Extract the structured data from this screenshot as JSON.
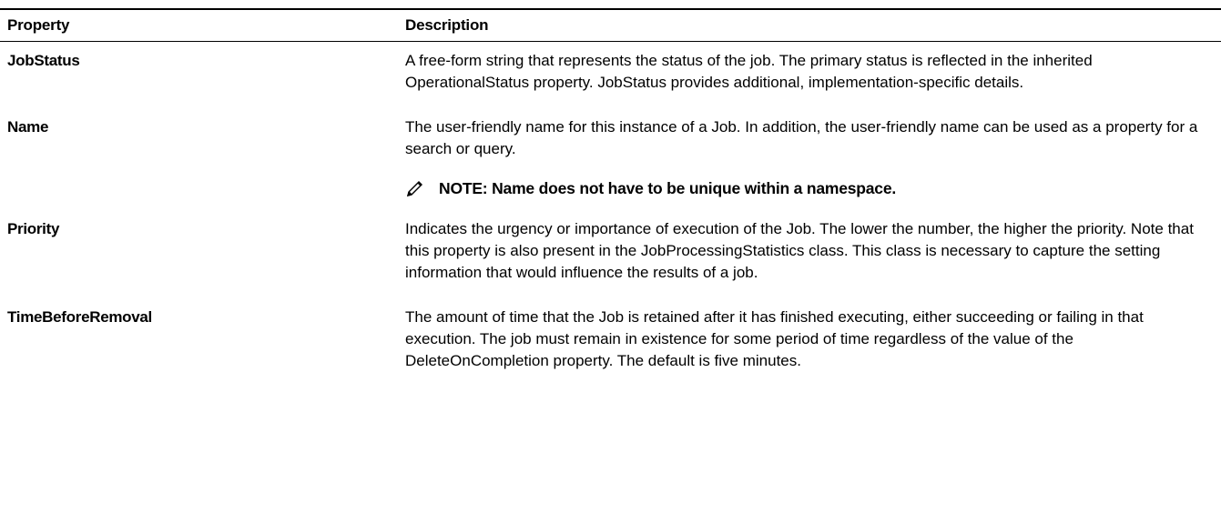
{
  "table": {
    "headers": {
      "property": "Property",
      "description": "Description"
    },
    "rows": [
      {
        "name": "JobStatus",
        "description": "A free-form string that represents the status of the job. The primary status is reflected in the inherited OperationalStatus property. JobStatus provides additional, implementation-specific details."
      },
      {
        "name": "Name",
        "description": "The user-friendly name for this instance of a Job. In addition, the user-friendly name can be used as a property for a search or query.",
        "note": "NOTE: Name does not have to be unique within a namespace."
      },
      {
        "name": "Priority",
        "description": "Indicates the urgency or importance of execution of the Job. The lower the number, the higher the priority. Note that this property is also present in the JobProcessingStatistics class. This class is necessary to capture the setting information that would influence the results of a job."
      },
      {
        "name": "TimeBeforeRemoval",
        "description": "The amount of time that the Job is retained after it has finished executing, either succeeding or failing in that execution. The job must remain in existence for some period of time regardless of the value of the DeleteOnCompletion property. The default is five minutes."
      }
    ]
  },
  "icons": {
    "note": "pencil-icon"
  }
}
